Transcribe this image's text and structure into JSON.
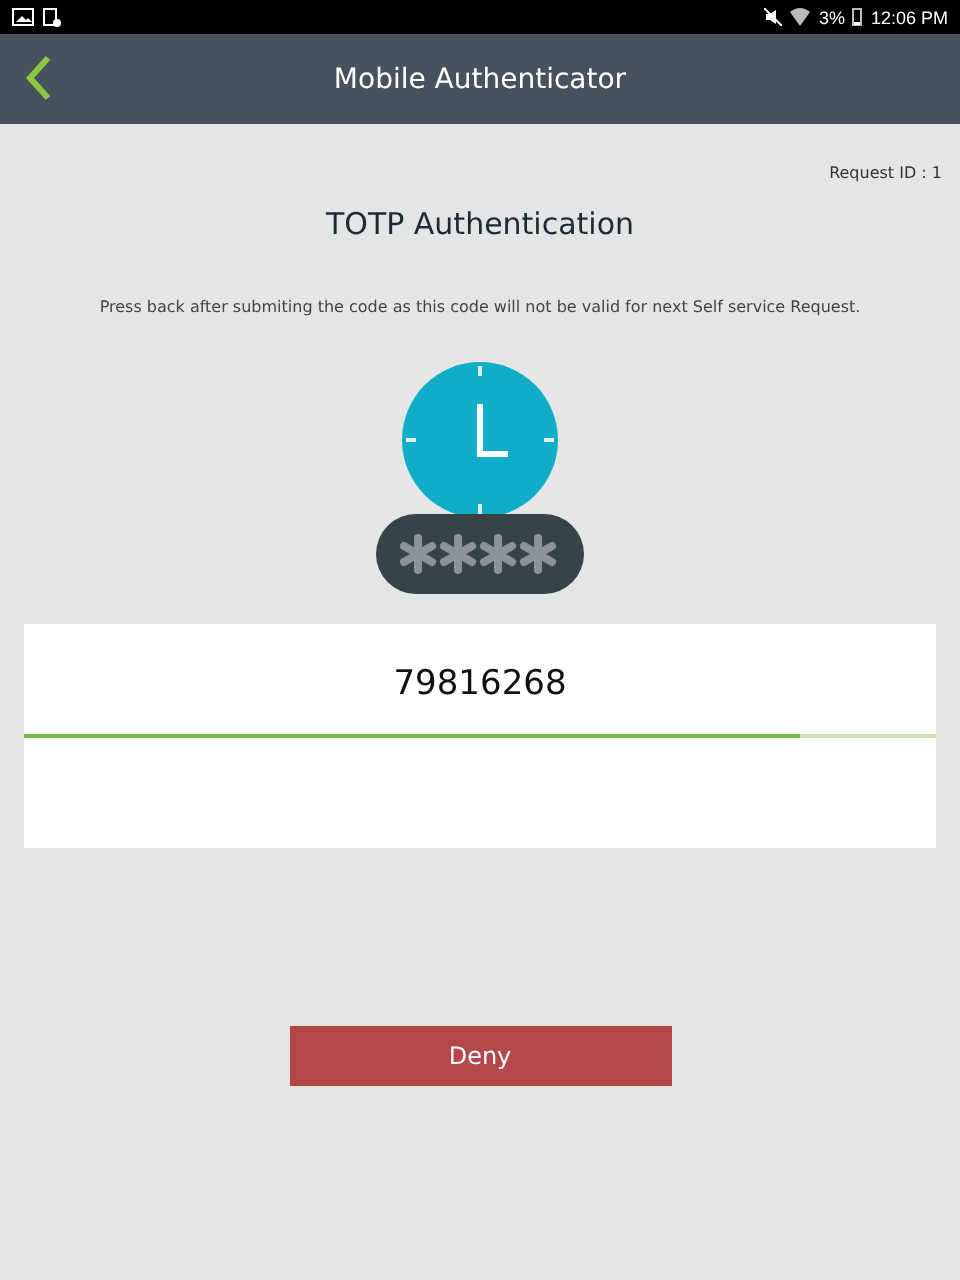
{
  "status_bar": {
    "battery": "3%",
    "time": "12:06 PM"
  },
  "app_bar": {
    "title": "Mobile Authenticator"
  },
  "request_id": "Request ID : 1",
  "heading": "TOTP Authentication",
  "note": "Press back after submiting the code as this code will not be valid for next Self service Request.",
  "code": {
    "value": "79816268",
    "level": 0.85
  },
  "buttons": [
    {
      "label": "Deny",
      "kind": "danger"
    }
  ]
}
